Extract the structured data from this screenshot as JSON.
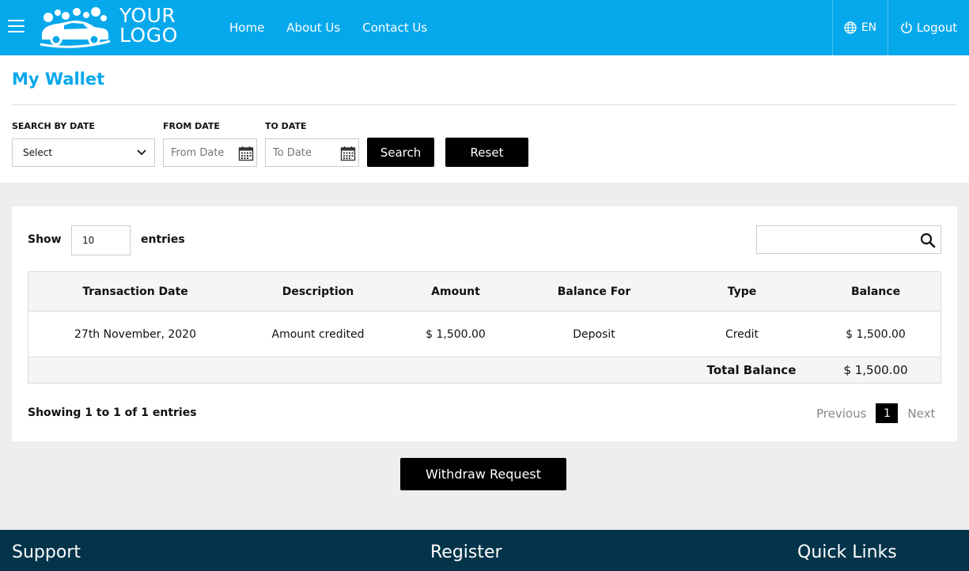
{
  "header": {
    "logo_line1": "YOUR",
    "logo_line2": "LOGO",
    "nav": [
      "Home",
      "About Us",
      "Contact Us"
    ],
    "language": "EN",
    "logout": "Logout",
    "brand_color": "#06a8ec"
  },
  "page": {
    "title": "My Wallet"
  },
  "filters": {
    "search_by_date_label": "SEARCH BY DATE",
    "select_value": "Select",
    "from_date_label": "FROM DATE",
    "from_date_placeholder": "From Date",
    "to_date_label": "TO DATE",
    "to_date_placeholder": "To Date",
    "search_button": "Search",
    "reset_button": "Reset"
  },
  "table_controls": {
    "show_label": "Show",
    "entries_value": "10",
    "entries_label": "entries",
    "search_placeholder": ""
  },
  "table": {
    "columns": [
      "Transaction Date",
      "Description",
      "Amount",
      "Balance For",
      "Type",
      "Balance"
    ],
    "rows": [
      [
        "27th November, 2020",
        "Amount credited",
        "$ 1,500.00",
        "Deposit",
        "Credit",
        "$ 1,500.00"
      ]
    ],
    "total_label": "Total Balance",
    "total_value": "$ 1,500.00"
  },
  "pagination": {
    "info": "Showing 1 to 1 of 1 entries",
    "previous": "Previous",
    "current_page": "1",
    "next": "Next"
  },
  "actions": {
    "withdraw_button": "Withdraw Request"
  },
  "footer": {
    "support": "Support",
    "register": "Register",
    "quick_links": "Quick Links",
    "footer_color": "#04344a"
  }
}
